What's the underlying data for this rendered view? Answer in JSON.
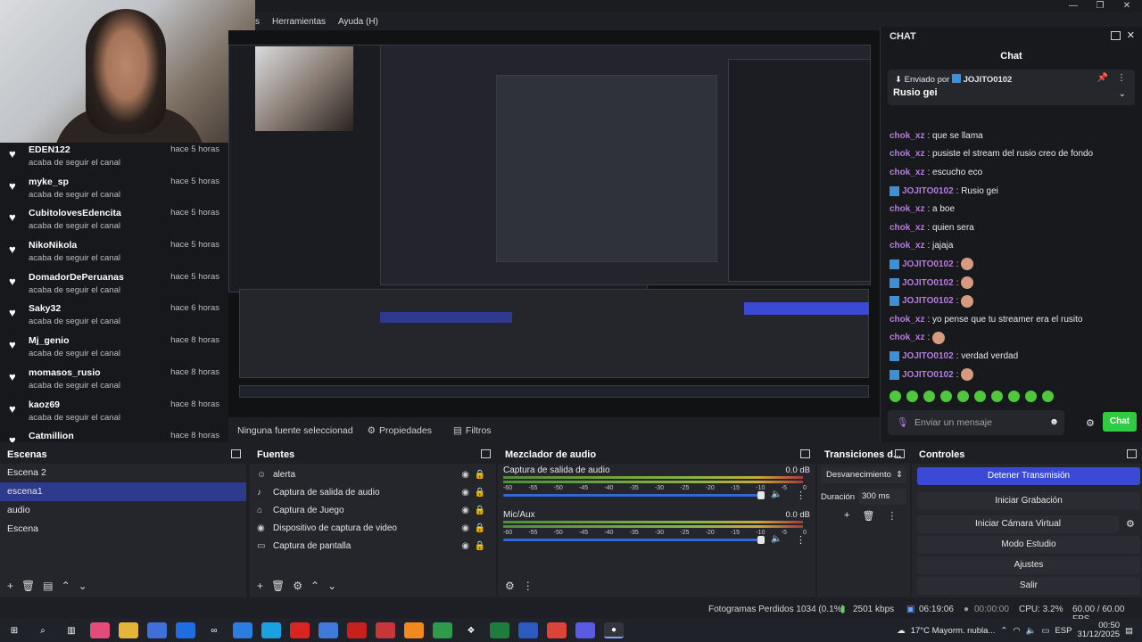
{
  "menu": {
    "items": [
      "s",
      "Herramientas",
      "Ayuda (H)"
    ]
  },
  "followers": [
    {
      "name": "EDEN122",
      "sub": "acaba de seguir el canal",
      "time": "hace 5 horas"
    },
    {
      "name": "myke_sp",
      "sub": "acaba de seguir el canal",
      "time": "hace 5 horas"
    },
    {
      "name": "CubitolovesEdencita",
      "sub": "acaba de seguir el canal",
      "time": "hace 5 horas"
    },
    {
      "name": "NikoNikola",
      "sub": "acaba de seguir el canal",
      "time": "hace 5 horas"
    },
    {
      "name": "DomadorDePeruanas",
      "sub": "acaba de seguir el canal",
      "time": "hace 5 horas"
    },
    {
      "name": "Saky32",
      "sub": "acaba de seguir el canal",
      "time": "hace 6 horas"
    },
    {
      "name": "Mj_genio",
      "sub": "acaba de seguir el canal",
      "time": "hace 8 horas"
    },
    {
      "name": "momasos_rusio",
      "sub": "acaba de seguir el canal",
      "time": "hace 8 horas"
    },
    {
      "name": "kaoz69",
      "sub": "acaba de seguir el canal",
      "time": "hace 8 horas"
    },
    {
      "name": "Catmillion",
      "sub": "",
      "time": "hace 8 horas"
    }
  ],
  "preview_bar": {
    "no_source": "Ninguna fuente seleccionad",
    "properties": "Propiedades",
    "filters": "Filtros"
  },
  "chat": {
    "title": "CHAT",
    "subtitle": "Chat",
    "pinned_by": "Enviado por",
    "pinned_user": "JOJITO0102",
    "pinned_msg": "Rusio gei",
    "messages": [
      {
        "user": "chok_xz",
        "color": "#b77ce0",
        "text": ": que se llama",
        "badge": false
      },
      {
        "user": "chok_xz",
        "color": "#b77ce0",
        "text": ": pusiste el stream del rusio creo de fondo",
        "badge": false
      },
      {
        "user": "chok_xz",
        "color": "#b77ce0",
        "text": ": escucho eco",
        "badge": false
      },
      {
        "user": "JOJITO0102",
        "color": "#b77ce0",
        "text": ": Rusio gei",
        "badge": true
      },
      {
        "user": "chok_xz",
        "color": "#b77ce0",
        "text": ": a boe",
        "badge": false
      },
      {
        "user": "chok_xz",
        "color": "#b77ce0",
        "text": ": quien sera",
        "badge": false
      },
      {
        "user": "chok_xz",
        "color": "#b77ce0",
        "text": ": jajaja",
        "badge": false
      },
      {
        "user": "JOJITO0102",
        "color": "#b77ce0",
        "text": ":",
        "badge": true,
        "emoji": true
      },
      {
        "user": "JOJITO0102",
        "color": "#b77ce0",
        "text": ":",
        "badge": true,
        "emoji": true
      },
      {
        "user": "JOJITO0102",
        "color": "#b77ce0",
        "text": ":",
        "badge": true,
        "emoji": true
      },
      {
        "user": "chok_xz",
        "color": "#b77ce0",
        "text": ": yo pense que tu streamer era el rusito",
        "badge": false
      },
      {
        "user": "chok_xz",
        "color": "#b77ce0",
        "text": ":",
        "badge": false,
        "emoji": true
      },
      {
        "user": "JOJITO0102",
        "color": "#b77ce0",
        "text": ": verdad verdad",
        "badge": true
      },
      {
        "user": "JOJITO0102",
        "color": "#b77ce0",
        "text": ":",
        "badge": true,
        "emoji": true
      }
    ],
    "input_placeholder": "Enviar un mensaje",
    "send_label": "Chat"
  },
  "scenes": {
    "title": "Escenas",
    "items": [
      "Escena 2",
      "escena1",
      "audio",
      "Escena"
    ],
    "selected": 1
  },
  "sources": {
    "title": "Fuentes",
    "items": [
      {
        "icon": "☺",
        "label": "alerta"
      },
      {
        "icon": "♪",
        "label": "Captura de salida de audio"
      },
      {
        "icon": "⌂",
        "label": "Captura de Juego"
      },
      {
        "icon": "◉",
        "label": "Dispositivo de captura de video"
      },
      {
        "icon": "▭",
        "label": "Captura de pantalla"
      }
    ]
  },
  "mixer": {
    "title": "Mezclador de audio",
    "channels": [
      {
        "label": "Captura de salida de audio",
        "db": "0.0 dB",
        "volume": 0.97
      },
      {
        "label": "Mic/Aux",
        "db": "0.0 dB",
        "volume": 0.97
      }
    ],
    "scale": [
      "-60",
      "-55",
      "-50",
      "-45",
      "-40",
      "-35",
      "-30",
      "-25",
      "-20",
      "-15",
      "-10",
      "-5",
      "0"
    ]
  },
  "transitions": {
    "title": "Transiciones d...",
    "type": "Desvanecimiento",
    "duration_label": "Duración",
    "duration_value": "300 ms"
  },
  "controls": {
    "title": "Controles",
    "buttons": [
      "Detener Transmisión",
      "Iniciar Grabación",
      "Iniciar Cámara Virtual",
      "Modo Estudio",
      "Ajustes",
      "Salir"
    ]
  },
  "status": {
    "dropped": "Fotogramas Perdidos 1034 (0.1%)",
    "bitrate": "2501 kbps",
    "stream_time": "06:19:06",
    "rec_time": "00:00:00",
    "cpu": "CPU: 3.2%",
    "fps": "60.00 / 60.00 FPS"
  },
  "taskbar": {
    "weather": "17°C  Mayorm. nubla...",
    "lang": "ESP",
    "time": "00:50",
    "date": "31/12/2025"
  }
}
